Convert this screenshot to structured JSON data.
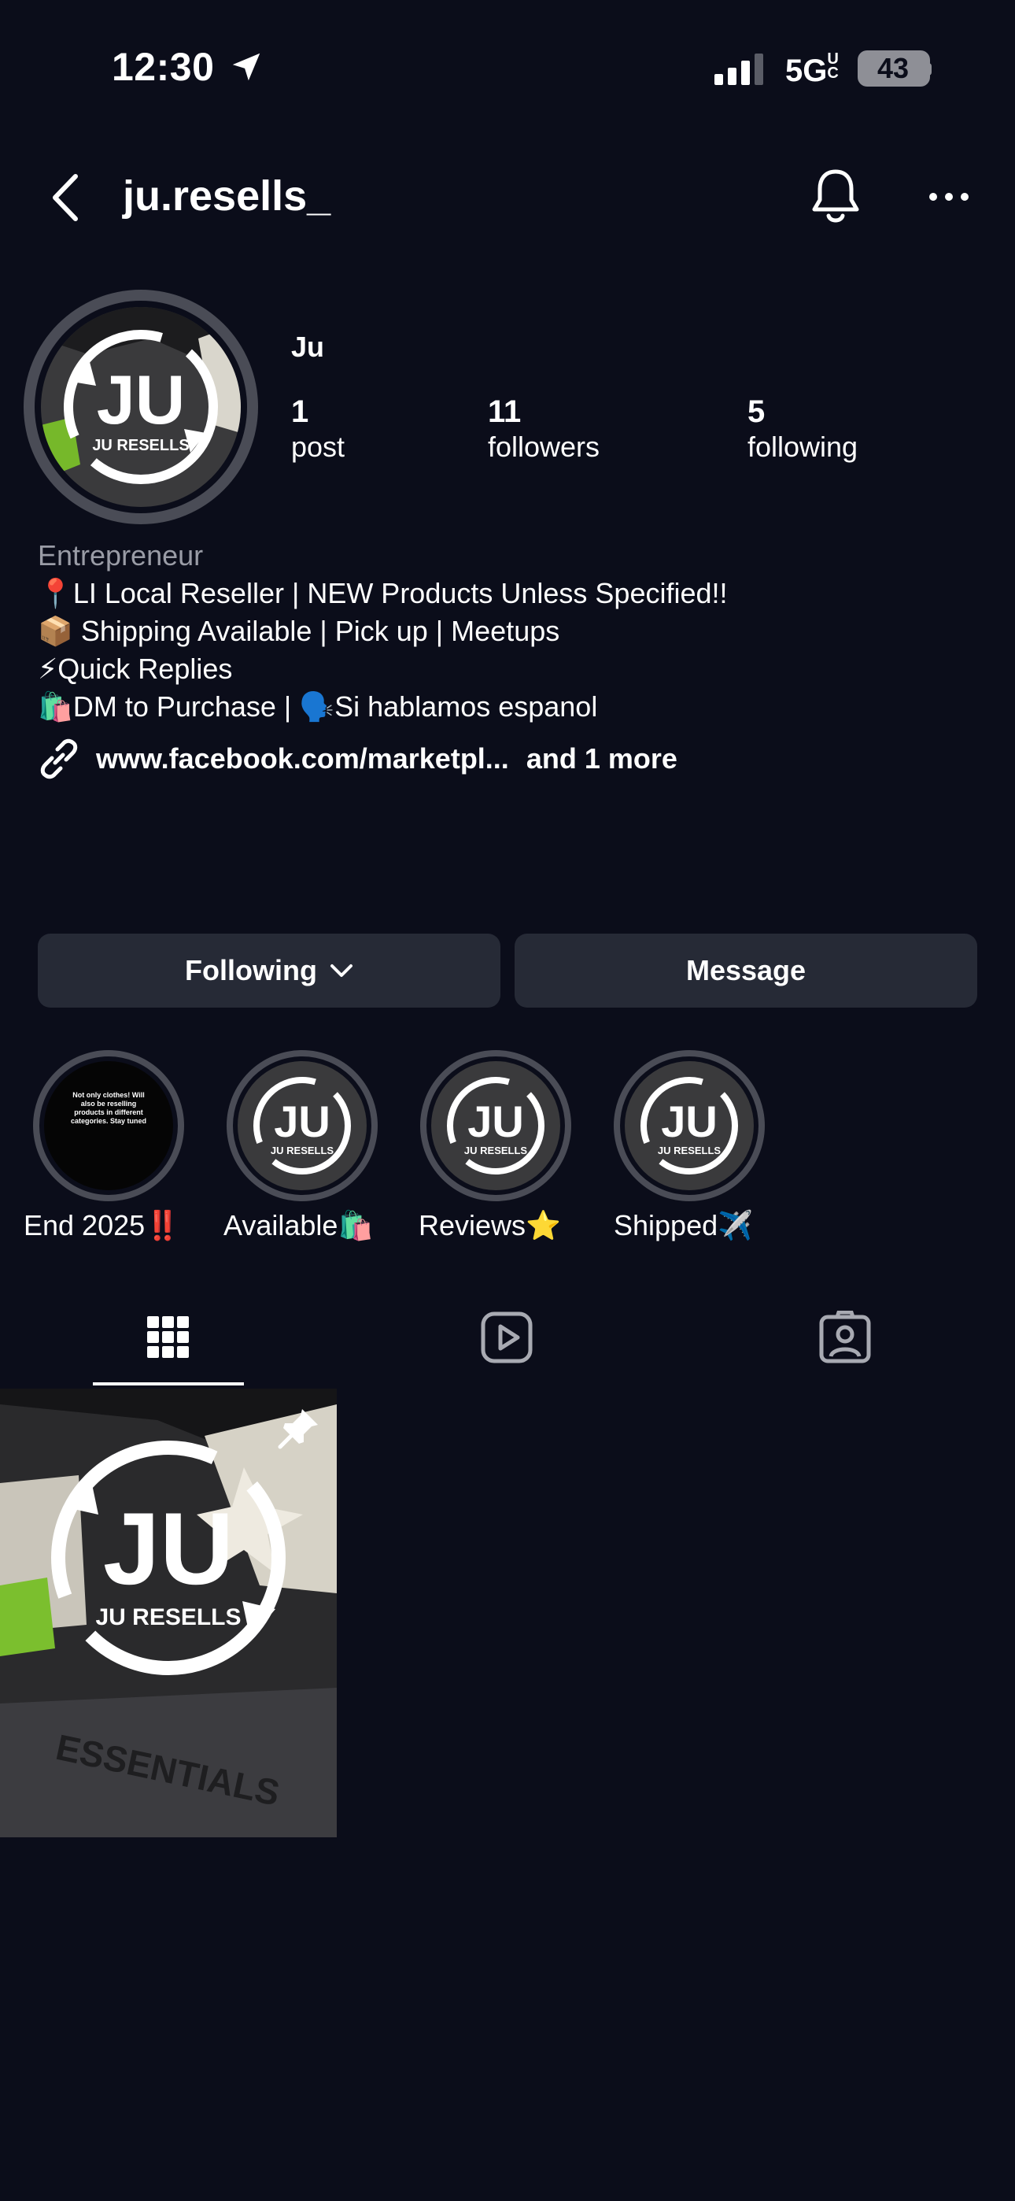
{
  "status_bar": {
    "time": "12:30",
    "network": "5G",
    "network_suffix": "UC",
    "battery": "43"
  },
  "header": {
    "username": "ju.resells_"
  },
  "profile": {
    "display_name": "Ju",
    "stats": [
      {
        "count": "1",
        "label": "post"
      },
      {
        "count": "11",
        "label": "followers"
      },
      {
        "count": "5",
        "label": "following"
      }
    ],
    "category": "Entrepreneur",
    "bio_lines": [
      "📍LI Local Reseller | NEW Products Unless Specified!!",
      "📦 Shipping Available | Pick up | Meetups",
      "⚡Quick Replies",
      "🛍️DM to Purchase | 🗣️Si hablamos espanol"
    ],
    "link": "www.facebook.com/marketpl...",
    "link_more": "and 1 more",
    "logo_text": "JU",
    "logo_subtext": "JU RESELLS"
  },
  "actions": {
    "following_label": "Following",
    "message_label": "Message"
  },
  "highlights": [
    {
      "label": "End 2025‼️",
      "cover_text": "Not only clothes! Will also be reselling products in different categories. Stay tuned"
    },
    {
      "label": "Available🛍️"
    },
    {
      "label": "Reviews⭐"
    },
    {
      "label": "Shipped✈️"
    }
  ],
  "tabs": [
    {
      "name": "grid",
      "icon": "grid-icon",
      "active": true
    },
    {
      "name": "reels",
      "icon": "reels-icon",
      "active": false
    },
    {
      "name": "tagged",
      "icon": "tagged-icon",
      "active": false
    }
  ],
  "posts": [
    {
      "pinned": true,
      "logo_text": "JU",
      "logo_subtext": "JU RESELLS",
      "shirt_text": "ESSENTIALS"
    }
  ],
  "colors": {
    "background": "#0b0d1a",
    "button": "#262a36",
    "ring": "#4a4c56",
    "muted_text": "#9a9ca6"
  }
}
